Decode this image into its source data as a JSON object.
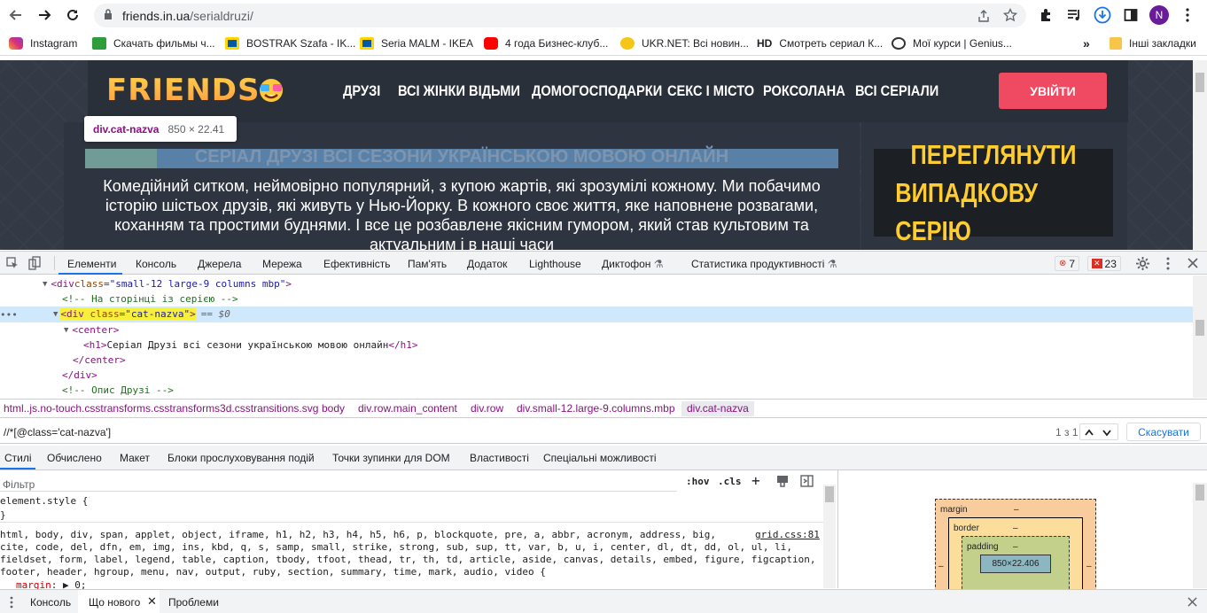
{
  "browser": {
    "url_host": "friends.in.ua",
    "url_path": "/serialdruzi/",
    "profile_initial": "N"
  },
  "bookmarks": [
    {
      "label": "Instagram",
      "color": "#e1306c"
    },
    {
      "label": "Скачать фильмы ч...",
      "color": "#2e9e3a"
    },
    {
      "label": "BOSTRAK Szafa - IK...",
      "color": "#ffd500"
    },
    {
      "label": "Seria MALM - IKEA",
      "color": "#0058a3"
    },
    {
      "label": "4 года Бизнес-клуб...",
      "color": "#ff0000"
    },
    {
      "label": "UKR.NET: Всі новин...",
      "color": "#f5c518"
    },
    {
      "label": "Смотреть сериал К...",
      "color": "#000000"
    },
    {
      "label": "Мої курси | Genius...",
      "color": "#333333"
    }
  ],
  "bookmarks_more": "»",
  "other_bookmarks": "Інші закладки",
  "site": {
    "logo": "FRIENDS",
    "nav": [
      "ДРУЗІ",
      "ВСІ ЖІНКИ ВІДЬМИ",
      "ДОМОГОСПОДАРКИ",
      "СЕКС І МІСТО",
      "РОКСОЛАНА",
      "ВСІ СЕРІАЛИ"
    ],
    "login": "УВІЙТИ",
    "title": "СЕРІАЛ ДРУЗІ ВСІ СЕЗОНИ УКРАЇНСЬКОЮ МОВОЮ ОНЛАЙН",
    "description": "Комедійний ситком, неймовірно популярний, з купою жартів, які зрозумілі кожному. Ми побачимо історію шістьох друзів, які живуть у Нью-Йорку. В кожного своє життя, яке наповнене розвагами, коханням та простими буднями. І все це розбавлене якісним гумором, який став культовим та актуальним і в наші часи",
    "random_line1": "ПЕРЕГЛЯНУТИ",
    "random_line2": "ВИПАДКОВУ СЕРІЮ"
  },
  "tooltip": {
    "selector": "div.cat-nazva",
    "size": "850 × 22.41"
  },
  "devtools": {
    "tabs": [
      "Елементи",
      "Консоль",
      "Джерела",
      "Мережа",
      "Ефективність",
      "Пам'ять",
      "Додаток",
      "Lighthouse",
      "Диктофон",
      "Статистика продуктивності"
    ],
    "errors": "7",
    "issues": "23",
    "dom_lines": [
      {
        "indent": 50,
        "arrow": "▼",
        "html": "<div class=\"small-12 large-9 columns mbp\">"
      },
      {
        "indent": 70,
        "arrow": "",
        "comment": "<!-- На сторінці із серією -->"
      },
      {
        "indent": 62,
        "arrow": "▼",
        "selected": true,
        "tag": "<div class=\"cat-nazva\">",
        "suffix": "== $0"
      },
      {
        "indent": 74,
        "arrow": "▼",
        "html": "<center>"
      },
      {
        "indent": 94,
        "arrow": "",
        "html": "<h1>Серіал Друзі всі сезони українською мовою онлайн</h1>"
      },
      {
        "indent": 82,
        "arrow": "",
        "html": "</center>"
      },
      {
        "indent": 70,
        "arrow": "",
        "html": "</div>"
      },
      {
        "indent": 70,
        "arrow": "",
        "comment": "<!-- Опис Друзі -->"
      }
    ],
    "breadcrumbs": [
      "html..js.no-touch.csstransforms.csstransforms3d.csstransitions.svg",
      "body",
      "div.row.main_content",
      "div.row",
      "div.small-12.large-9.columns.mbp",
      "div.cat-nazva"
    ],
    "search_query": "//*[@class='cat-nazva']",
    "search_count": "1 з 1",
    "search_cancel": "Скасувати",
    "style_tabs": [
      "Стилі",
      "Обчислено",
      "Макет",
      "Блоки прослуховування подій",
      "Точки зупинки для DOM",
      "Властивості",
      "Спеціальні можливості"
    ],
    "filter_placeholder": "Фільтр",
    "hov": ":hov",
    "cls": ".cls",
    "element_style": "element.style {",
    "close_brace": "}",
    "rule_source": "grid.css:81",
    "rule_selectors_1": "html, body, div, span, applet, object, iframe, h1, h2, h3, h4, h5, h6, p, blockquote, pre, a, abbr, acronym, address, big,",
    "rule_selectors_2": "cite, code, del, dfn, em, img, ins, kbd, q, s, samp, small, strike, strong, sub, sup, tt, var, b, u, i, center, dl, dt, dd, ol, ul, li,",
    "rule_selectors_3": "fieldset, form, label, legend, table, caption, tbody, tfoot, thead, tr, th, td, article, aside, canvas, details, embed, figure, figcaption,",
    "rule_selectors_4": "footer, header, hgroup, menu, nav, output, ruby, section, summary, time, mark, audio, video {",
    "rule_prop": "margin",
    "rule_val": "0;",
    "box_margin": "margin",
    "box_border": "border",
    "box_padding": "padding",
    "box_content": "850×22.406",
    "box_dash": "–",
    "drawer_tabs": [
      "Консоль",
      "Що нового",
      "Проблеми"
    ]
  }
}
